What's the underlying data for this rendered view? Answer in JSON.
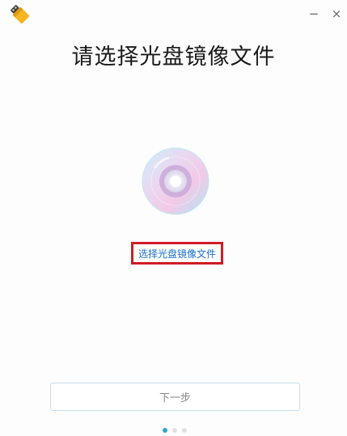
{
  "window": {
    "minimize_glyph": "−",
    "close_glyph": "×",
    "app_icon": "usb-drive-icon"
  },
  "main": {
    "title": "请选择光盘镜像文件",
    "disc_icon": "disc-icon",
    "select_link": "选择光盘镜像文件"
  },
  "footer": {
    "next_label": "下一步",
    "pager": {
      "total": 3,
      "current": 1
    }
  },
  "colors": {
    "highlight_border": "#d01c25",
    "link": "#1d6fc9",
    "pager_active": "#28a7c9"
  }
}
